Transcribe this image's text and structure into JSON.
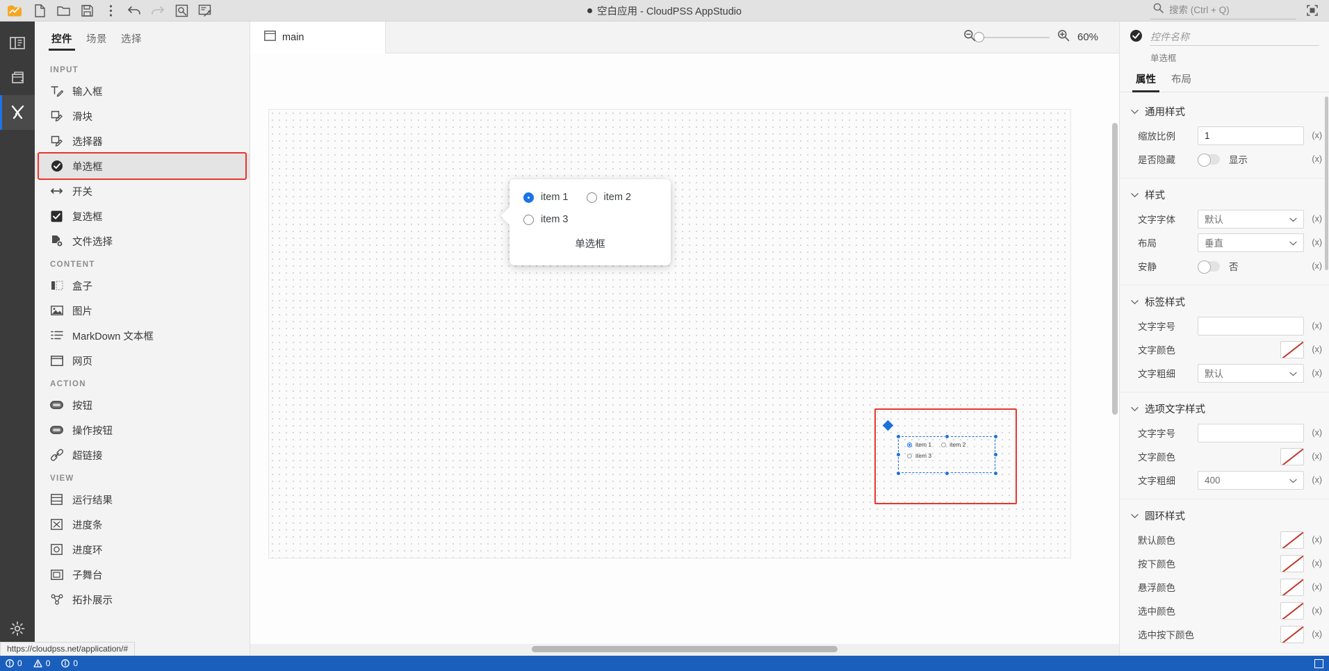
{
  "titlebar": {
    "title": "空白应用 - CloudPSS AppStudio",
    "tools": [
      {
        "name": "new-file",
        "tip": "新建"
      },
      {
        "name": "open-folder",
        "tip": "打开"
      },
      {
        "name": "save",
        "tip": "保存"
      },
      {
        "name": "more-options",
        "tip": "更多"
      },
      {
        "name": "undo",
        "tip": "撤销"
      },
      {
        "name": "redo",
        "tip": "重做"
      },
      {
        "name": "preview",
        "tip": "预览"
      },
      {
        "name": "publish",
        "tip": "发布"
      }
    ],
    "search_placeholder": "搜索 (Ctrl + Q)",
    "maximize_label": "全屏"
  },
  "rail": {
    "items": [
      {
        "name": "explorer",
        "label": "资源管理器",
        "active": false
      },
      {
        "name": "scenes",
        "label": "场景",
        "active": false
      },
      {
        "name": "tools",
        "label": "工具",
        "active": true
      }
    ],
    "settings_label": "设置"
  },
  "palette": {
    "tabs": [
      {
        "label": "控件",
        "active": true
      },
      {
        "label": "场景",
        "active": false
      },
      {
        "label": "选择",
        "active": false
      }
    ],
    "groups": [
      {
        "title": "INPUT",
        "items": [
          {
            "label": "输入框",
            "icon": "text-input-icon",
            "selected": false
          },
          {
            "label": "滑块",
            "icon": "slider-icon",
            "selected": false
          },
          {
            "label": "选择器",
            "icon": "select-icon",
            "selected": false
          },
          {
            "label": "单选框",
            "icon": "radio-icon",
            "selected": true
          },
          {
            "label": "开关",
            "icon": "switch-icon",
            "selected": false
          },
          {
            "label": "复选框",
            "icon": "checkbox-icon",
            "selected": false
          },
          {
            "label": "文件选择",
            "icon": "file-picker-icon",
            "selected": false
          }
        ]
      },
      {
        "title": "CONTENT",
        "items": [
          {
            "label": "盒子",
            "icon": "box-icon",
            "selected": false
          },
          {
            "label": "图片",
            "icon": "image-icon",
            "selected": false
          },
          {
            "label": "MarkDown 文本框",
            "icon": "markdown-icon",
            "selected": false
          },
          {
            "label": "网页",
            "icon": "webpage-icon",
            "selected": false
          }
        ]
      },
      {
        "title": "ACTION",
        "items": [
          {
            "label": "按钮",
            "icon": "button-icon",
            "selected": false
          },
          {
            "label": "操作按钮",
            "icon": "action-button-icon",
            "selected": false
          },
          {
            "label": "超链接",
            "icon": "link-icon",
            "selected": false
          }
        ]
      },
      {
        "title": "VIEW",
        "items": [
          {
            "label": "运行结果",
            "icon": "result-icon",
            "selected": false
          },
          {
            "label": "进度条",
            "icon": "progress-bar-icon",
            "selected": false
          },
          {
            "label": "进度环",
            "icon": "progress-ring-icon",
            "selected": false
          },
          {
            "label": "子舞台",
            "icon": "sub-stage-icon",
            "selected": false
          },
          {
            "label": "拓扑展示",
            "icon": "topology-icon",
            "selected": false
          }
        ]
      }
    ]
  },
  "editor": {
    "tab_label": "main",
    "zoom_percent": "60%",
    "preview_popup": {
      "options": [
        {
          "label": "item 1",
          "checked": true
        },
        {
          "label": "item 2",
          "checked": false
        },
        {
          "label": "item 3",
          "checked": false
        }
      ],
      "caption": "单选框"
    },
    "canvas_widget": {
      "options": [
        {
          "label": "item 1",
          "checked": true
        },
        {
          "label": "item 2",
          "checked": false
        },
        {
          "label": "item 3",
          "checked": false
        }
      ]
    }
  },
  "properties": {
    "name_placeholder": "控件名称",
    "name_value": "",
    "component_type": "单选框",
    "tabs": [
      {
        "label": "属性",
        "active": true
      },
      {
        "label": "布局",
        "active": false
      }
    ],
    "sections": [
      {
        "title": "通用样式",
        "rows": [
          {
            "label": "缩放比例",
            "type": "text",
            "value": "1",
            "expr": "(x)"
          },
          {
            "label": "是否隐藏",
            "type": "toggle",
            "value": "显示",
            "expr": "(x)"
          }
        ]
      },
      {
        "title": "样式",
        "rows": [
          {
            "label": "文字字体",
            "type": "select",
            "value": "默认",
            "expr": "(x)"
          },
          {
            "label": "布局",
            "type": "select",
            "value": "垂直",
            "expr": "(x)"
          },
          {
            "label": "安静",
            "type": "toggle",
            "value": "否",
            "expr": "(x)"
          }
        ]
      },
      {
        "title": "标签样式",
        "rows": [
          {
            "label": "文字字号",
            "type": "text",
            "value": "",
            "expr": "(x)"
          },
          {
            "label": "文字颜色",
            "type": "color",
            "value": "",
            "expr": "(x)"
          },
          {
            "label": "文字粗细",
            "type": "select",
            "value": "默认",
            "expr": "(x)"
          }
        ]
      },
      {
        "title": "选项文字样式",
        "rows": [
          {
            "label": "文字字号",
            "type": "text",
            "value": "",
            "expr": "(x)"
          },
          {
            "label": "文字颜色",
            "type": "color",
            "value": "",
            "expr": "(x)"
          },
          {
            "label": "文字粗细",
            "type": "select",
            "value": "400",
            "expr": "(x)"
          }
        ]
      },
      {
        "title": "圆环样式",
        "rows": [
          {
            "label": "默认颜色",
            "type": "color",
            "value": "",
            "expr": "(x)"
          },
          {
            "label": "按下颜色",
            "type": "color",
            "value": "",
            "expr": "(x)"
          },
          {
            "label": "悬浮颜色",
            "type": "color",
            "value": "",
            "expr": "(x)"
          },
          {
            "label": "选中颜色",
            "type": "color",
            "value": "",
            "expr": "(x)"
          },
          {
            "label": "选中按下颜色",
            "type": "color",
            "value": "",
            "expr": "(x)"
          }
        ]
      }
    ]
  },
  "statusbar": {
    "url_hint": "https://cloudpss.net/application/#",
    "errors": "0",
    "warnings": "0",
    "infos": "0"
  },
  "colors": {
    "accent_blue": "#1a73e8",
    "highlight_red": "#e8352c",
    "status_bar": "#1b5fbd",
    "rail_dark": "#3b3b3b"
  }
}
